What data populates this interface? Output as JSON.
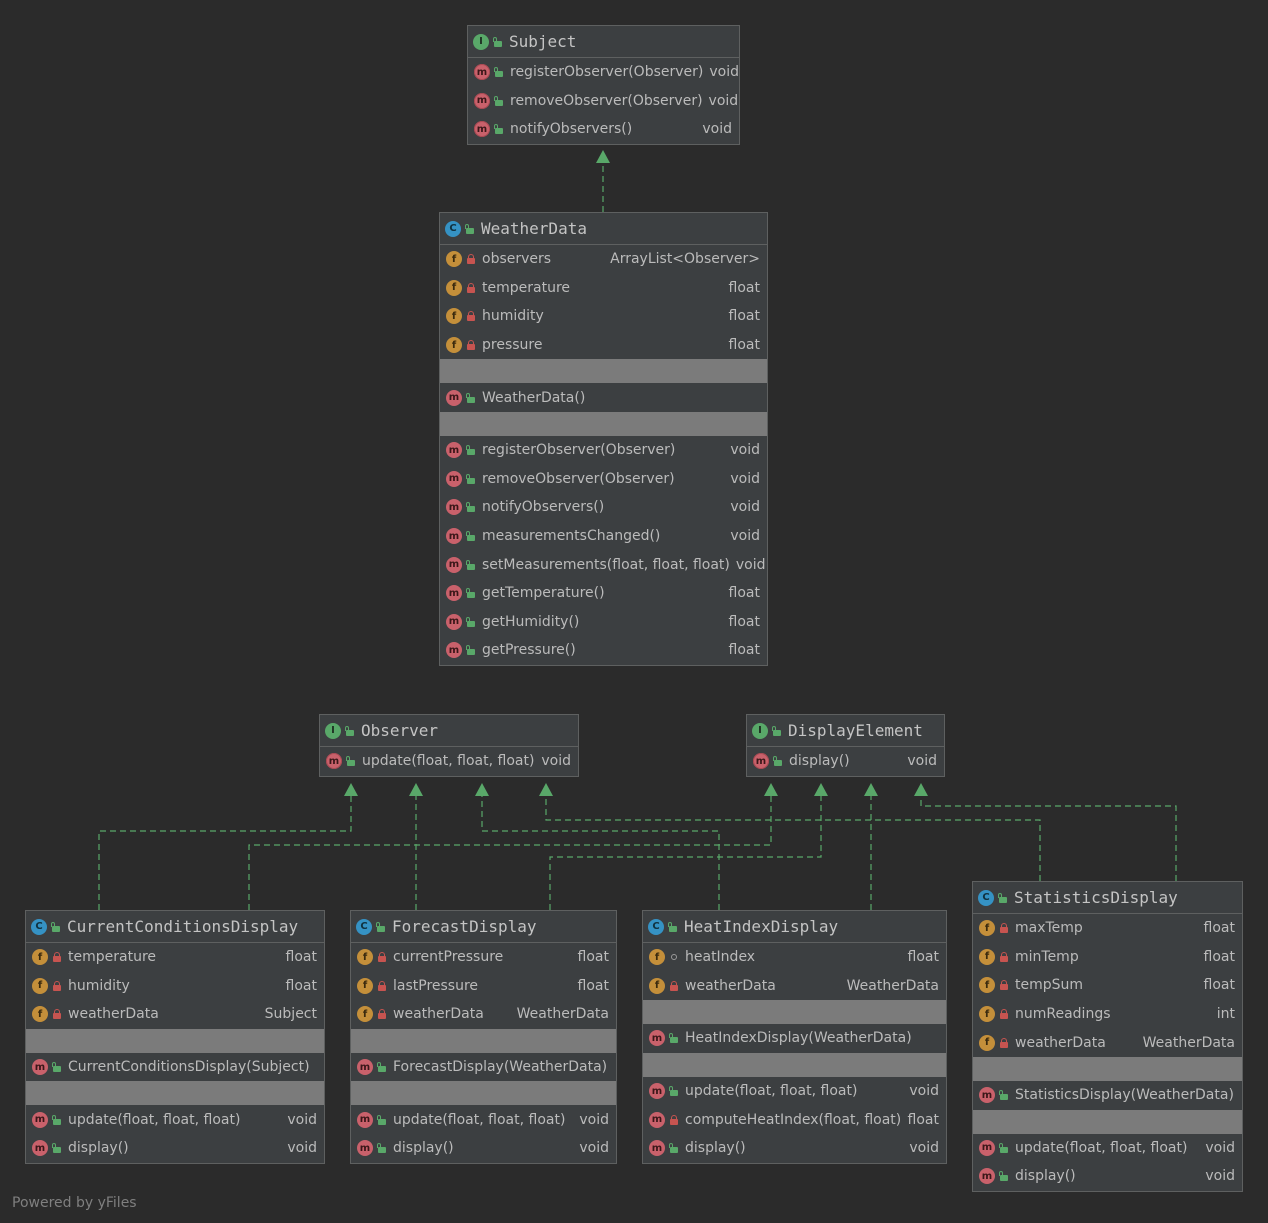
{
  "nodes": {
    "subject": {
      "name": "Subject",
      "kind": "I",
      "methods": [
        {
          "name": "registerObserver(Observer)",
          "type": "void",
          "vis": "public",
          "abstract": true
        },
        {
          "name": "removeObserver(Observer)",
          "type": "void",
          "vis": "public",
          "abstract": true
        },
        {
          "name": "notifyObservers()",
          "type": "void",
          "vis": "public",
          "abstract": true
        }
      ]
    },
    "weatherdata": {
      "name": "WeatherData",
      "kind": "C",
      "fields": [
        {
          "name": "observers",
          "type": "ArrayList<Observer>",
          "vis": "private"
        },
        {
          "name": "temperature",
          "type": "float",
          "vis": "private"
        },
        {
          "name": "humidity",
          "type": "float",
          "vis": "private"
        },
        {
          "name": "pressure",
          "type": "float",
          "vis": "private"
        }
      ],
      "constructors": [
        {
          "name": "WeatherData()",
          "type": "",
          "vis": "public"
        }
      ],
      "methods": [
        {
          "name": "registerObserver(Observer)",
          "type": "void",
          "vis": "public"
        },
        {
          "name": "removeObserver(Observer)",
          "type": "void",
          "vis": "public"
        },
        {
          "name": "notifyObservers()",
          "type": "void",
          "vis": "public"
        },
        {
          "name": "measurementsChanged()",
          "type": "void",
          "vis": "public"
        },
        {
          "name": "setMeasurements(float, float, float)",
          "type": "void",
          "vis": "public"
        },
        {
          "name": "getTemperature()",
          "type": "float",
          "vis": "public"
        },
        {
          "name": "getHumidity()",
          "type": "float",
          "vis": "public"
        },
        {
          "name": "getPressure()",
          "type": "float",
          "vis": "public"
        }
      ]
    },
    "observer": {
      "name": "Observer",
      "kind": "I",
      "methods": [
        {
          "name": "update(float, float, float)",
          "type": "void",
          "vis": "public",
          "abstract": true
        }
      ]
    },
    "displayelement": {
      "name": "DisplayElement",
      "kind": "I",
      "methods": [
        {
          "name": "display()",
          "type": "void",
          "vis": "public",
          "abstract": true
        }
      ]
    },
    "currentconditions": {
      "name": "CurrentConditionsDisplay",
      "kind": "C",
      "fields": [
        {
          "name": "temperature",
          "type": "float",
          "vis": "private"
        },
        {
          "name": "humidity",
          "type": "float",
          "vis": "private"
        },
        {
          "name": "weatherData",
          "type": "Subject",
          "vis": "private"
        }
      ],
      "constructors": [
        {
          "name": "CurrentConditionsDisplay(Subject)",
          "type": "",
          "vis": "public"
        }
      ],
      "methods": [
        {
          "name": "update(float, float, float)",
          "type": "void",
          "vis": "public"
        },
        {
          "name": "display()",
          "type": "void",
          "vis": "public"
        }
      ]
    },
    "forecast": {
      "name": "ForecastDisplay",
      "kind": "C",
      "fields": [
        {
          "name": "currentPressure",
          "type": "float",
          "vis": "private"
        },
        {
          "name": "lastPressure",
          "type": "float",
          "vis": "private"
        },
        {
          "name": "weatherData",
          "type": "WeatherData",
          "vis": "private"
        }
      ],
      "constructors": [
        {
          "name": "ForecastDisplay(WeatherData)",
          "type": "",
          "vis": "public"
        }
      ],
      "methods": [
        {
          "name": "update(float, float, float)",
          "type": "void",
          "vis": "public"
        },
        {
          "name": "display()",
          "type": "void",
          "vis": "public"
        }
      ]
    },
    "heatindex": {
      "name": "HeatIndexDisplay",
      "kind": "C",
      "fields": [
        {
          "name": "heatIndex",
          "type": "float",
          "vis": "package"
        },
        {
          "name": "weatherData",
          "type": "WeatherData",
          "vis": "private"
        }
      ],
      "constructors": [
        {
          "name": "HeatIndexDisplay(WeatherData)",
          "type": "",
          "vis": "public"
        }
      ],
      "methods": [
        {
          "name": "update(float, float, float)",
          "type": "void",
          "vis": "public"
        },
        {
          "name": "computeHeatIndex(float, float)",
          "type": "float",
          "vis": "private"
        },
        {
          "name": "display()",
          "type": "void",
          "vis": "public"
        }
      ]
    },
    "statistics": {
      "name": "StatisticsDisplay",
      "kind": "C",
      "fields": [
        {
          "name": "maxTemp",
          "type": "float",
          "vis": "private"
        },
        {
          "name": "minTemp",
          "type": "float",
          "vis": "private"
        },
        {
          "name": "tempSum",
          "type": "float",
          "vis": "private"
        },
        {
          "name": "numReadings",
          "type": "int",
          "vis": "private"
        },
        {
          "name": "weatherData",
          "type": "WeatherData",
          "vis": "private"
        }
      ],
      "constructors": [
        {
          "name": "StatisticsDisplay(WeatherData)",
          "type": "",
          "vis": "public"
        }
      ],
      "methods": [
        {
          "name": "update(float, float, float)",
          "type": "void",
          "vis": "public"
        },
        {
          "name": "display()",
          "type": "void",
          "vis": "public"
        }
      ]
    }
  },
  "edges": [
    {
      "from": "weatherdata",
      "to": "subject",
      "kind": "implements"
    },
    {
      "from": "currentconditions",
      "to": "observer",
      "kind": "implements"
    },
    {
      "from": "currentconditions",
      "to": "displayelement",
      "kind": "implements"
    },
    {
      "from": "forecast",
      "to": "observer",
      "kind": "implements"
    },
    {
      "from": "forecast",
      "to": "displayelement",
      "kind": "implements"
    },
    {
      "from": "heatindex",
      "to": "observer",
      "kind": "implements"
    },
    {
      "from": "heatindex",
      "to": "displayelement",
      "kind": "implements"
    },
    {
      "from": "statistics",
      "to": "observer",
      "kind": "implements"
    },
    {
      "from": "statistics",
      "to": "displayelement",
      "kind": "implements"
    }
  ],
  "colors": {
    "background": "#2b2b2b",
    "node_fill": "#3c3f41",
    "separator": "#7b7b7b",
    "edge": "#59a869",
    "interface_badge": "#59a869",
    "class_badge": "#3592c4",
    "field_badge": "#c48f3a",
    "method_badge": "#c9616b"
  },
  "footer": "Powered by yFiles"
}
